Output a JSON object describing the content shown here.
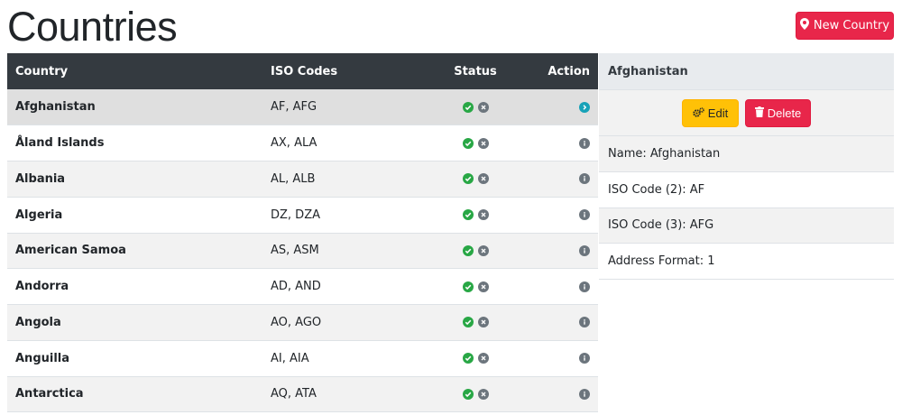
{
  "header": {
    "title": "Countries",
    "new_button_label": "New Country"
  },
  "table": {
    "columns": {
      "country": "Country",
      "iso": "ISO Codes",
      "status": "Status",
      "action": "Action"
    },
    "rows": [
      {
        "country": "Afghanistan",
        "iso": "AF, AFG"
      },
      {
        "country": "Åland Islands",
        "iso": "AX, ALA"
      },
      {
        "country": "Albania",
        "iso": "AL, ALB"
      },
      {
        "country": "Algeria",
        "iso": "DZ, DZA"
      },
      {
        "country": "American Samoa",
        "iso": "AS, ASM"
      },
      {
        "country": "Andorra",
        "iso": "AD, AND"
      },
      {
        "country": "Angola",
        "iso": "AO, AGO"
      },
      {
        "country": "Anguilla",
        "iso": "AI, AIA"
      },
      {
        "country": "Antarctica",
        "iso": "AQ, ATA"
      }
    ]
  },
  "panel": {
    "title": "Afghanistan",
    "edit_label": "Edit",
    "delete_label": "Delete",
    "details": [
      "Name: Afghanistan",
      "ISO Code (2): AF",
      "ISO Code (3): AFG",
      "Address Format: 1"
    ]
  },
  "icons": {
    "new": "map-marker-icon",
    "edit": "cogs-icon",
    "delete": "trash-icon",
    "status_ok": "check-circle-icon",
    "status_x": "times-circle-icon",
    "info": "info-circle-icon",
    "selected": "chevron-right-circle-icon"
  },
  "colors": {
    "header_dark": "#343a40",
    "danger": "#e8264a",
    "warning": "#ffc107",
    "success": "#28a745",
    "info": "#17a2b8",
    "secondary": "#6c757d"
  }
}
